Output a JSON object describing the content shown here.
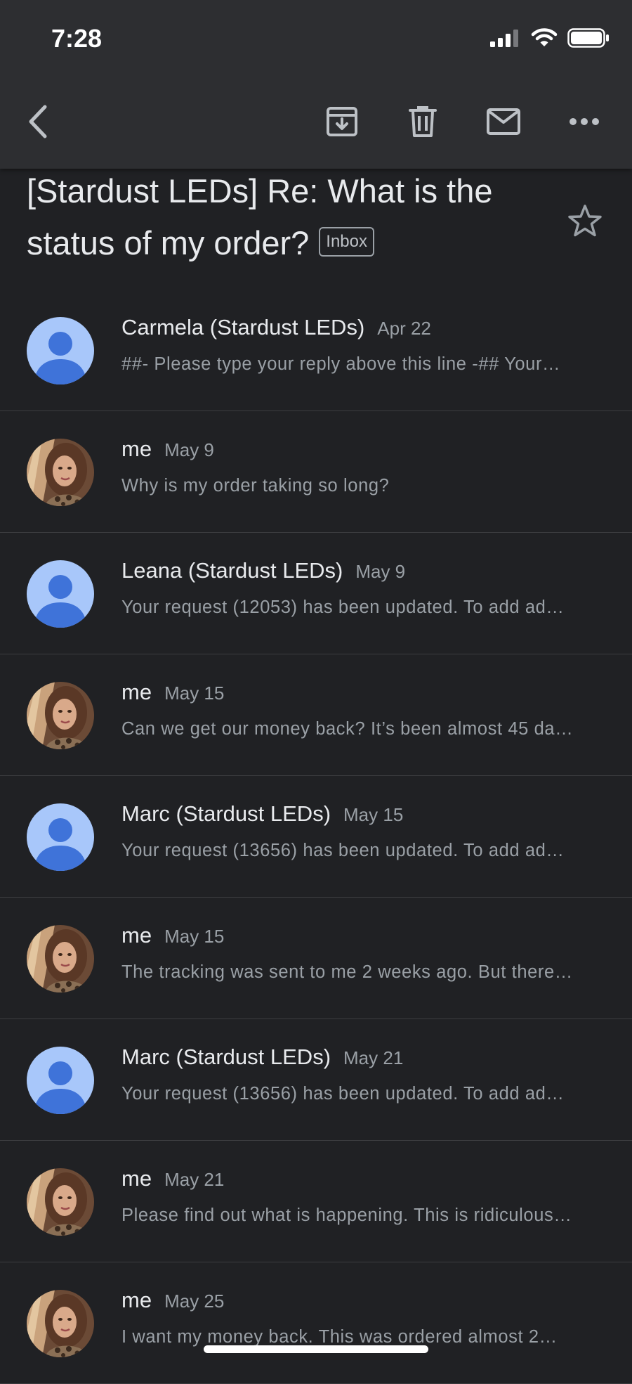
{
  "status_bar": {
    "time": "7:28"
  },
  "toolbar": {
    "back_icon": "chevron-left-icon",
    "archive_icon": "archive-icon",
    "delete_icon": "trash-icon",
    "mark_unread_icon": "mail-icon",
    "more_icon": "more-horizontal-icon"
  },
  "subject": {
    "line1": "[Stardust LEDs] Re: What is the",
    "line2": "status of my order?",
    "label": "Inbox"
  },
  "messages": [
    {
      "sender": "Carmela (Stardust LEDs)",
      "date": "Apr 22",
      "snippet": "##- Please type your reply above this line -## Your…",
      "avatar": "default-avatar"
    },
    {
      "sender": "me",
      "date": "May 9",
      "snippet": "Why is my order taking so long?",
      "avatar": "user-photo"
    },
    {
      "sender": "Leana (Stardust LEDs)",
      "date": "May 9",
      "snippet": "Your request (12053) has been updated. To add ad…",
      "avatar": "default-avatar"
    },
    {
      "sender": "me",
      "date": "May 15",
      "snippet": "Can we get our money back? It’s been almost 45 da…",
      "avatar": "user-photo"
    },
    {
      "sender": "Marc (Stardust LEDs)",
      "date": "May 15",
      "snippet": "Your request (13656) has been updated. To add ad…",
      "avatar": "default-avatar"
    },
    {
      "sender": "me",
      "date": "May 15",
      "snippet": "The tracking was sent to me 2 weeks ago. But there…",
      "avatar": "user-photo"
    },
    {
      "sender": "Marc (Stardust LEDs)",
      "date": "May 21",
      "snippet": "Your request (13656) has been updated. To add ad…",
      "avatar": "default-avatar"
    },
    {
      "sender": "me",
      "date": "May 21",
      "snippet": "Please find out what is happening. This is ridiculous…",
      "avatar": "user-photo"
    },
    {
      "sender": "me",
      "date": "May 25",
      "snippet": "I want my money back. This was ordered almost 2…",
      "avatar": "user-photo"
    }
  ],
  "colors": {
    "background": "#202124",
    "toolbar": "#2d2e31",
    "default_avatar_bg": "#a8c7fa",
    "default_avatar_fg": "#3f73d9"
  }
}
